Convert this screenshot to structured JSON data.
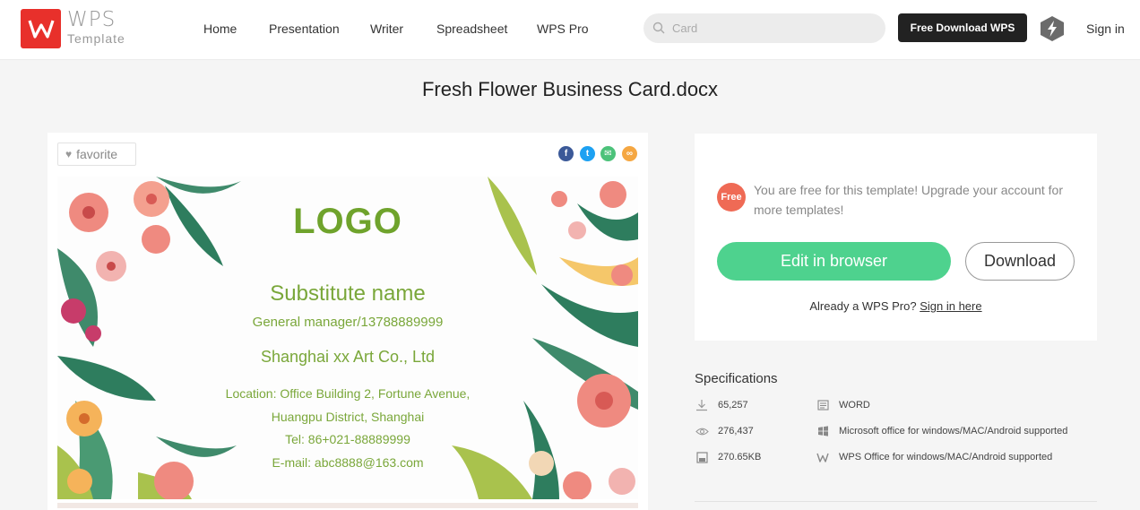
{
  "header": {
    "logo_line1": "WPS",
    "logo_line2": "Template",
    "nav": [
      "Home",
      "Presentation",
      "Writer",
      "Spreadsheet",
      "WPS Pro"
    ],
    "search_placeholder": "Card",
    "download_label": "Free Download WPS",
    "signin_label": "Sign in"
  },
  "title": "Fresh Flower Business Card.docx",
  "preview": {
    "favorite_label": "favorite",
    "share": [
      {
        "name": "facebook",
        "color": "#3b5998",
        "glyph": "f"
      },
      {
        "name": "twitter",
        "color": "#1da1f2",
        "glyph": "t"
      },
      {
        "name": "email",
        "color": "#4cc27a",
        "glyph": "✉"
      },
      {
        "name": "link",
        "color": "#f5a742",
        "glyph": "∞"
      }
    ],
    "card": {
      "logo": "LOGO",
      "name": "Substitute name",
      "role": "General manager/13788889999",
      "company": "Shanghai xx Art Co., Ltd",
      "location_line1": "Location: Office Building 2, Fortune Avenue,",
      "location_line2": "Huangpu District, Shanghai",
      "tel": "Tel: 86+021-88889999",
      "email": "E-mail: abc8888@163.com"
    }
  },
  "panel": {
    "free_badge": "Free",
    "free_text": "You are free for this template! Upgrade your account for more templates!",
    "edit_label": "Edit in browser",
    "download_label": "Download",
    "already_text": "Already a WPS Pro?",
    "signin_here": "Sign in here"
  },
  "specifications": {
    "title": "Specifications",
    "downloads": "65,257",
    "views": "276,437",
    "size": "270.65KB",
    "format": "WORD",
    "compat_ms": "Microsoft office for windows/MAC/Android supported",
    "compat_wps": "WPS Office for windows/MAC/Android supported"
  },
  "colors": {
    "brand_red": "#e8302b",
    "edit_green": "#4ed28e",
    "card_green": "#7aa73a",
    "free_badge": "#ef6a55"
  }
}
